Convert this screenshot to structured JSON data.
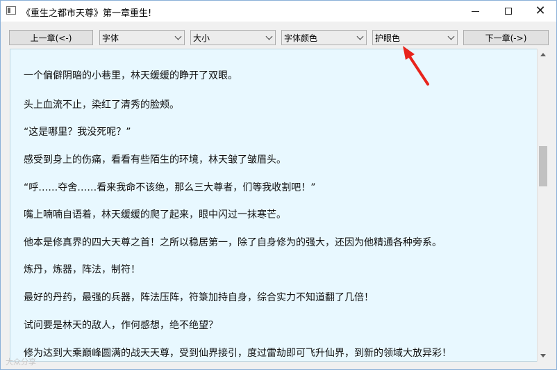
{
  "window": {
    "title": "《重生之都市天尊》第一章重生!",
    "controls": {
      "minimize": "minimize",
      "maximize": "maximize",
      "close": "close"
    }
  },
  "toolbar": {
    "prev_label": "上一章(<-)",
    "font_label": "字体",
    "size_label": "大小",
    "color_label": "字体颜色",
    "eye_label": "护眼色",
    "next_label": "下一章(->)"
  },
  "content": {
    "paragraphs": [
      "一个偏僻阴暗的小巷里，林天缓缓的睁开了双眼。",
      "头上血流不止，染红了清秀的脸颊。",
      "“这是哪里？我没死呢？”",
      "感受到身上的伤痛，看看有些陌生的环境，林天皱了皱眉头。",
      "“呼……夺舍……看来我命不该绝，那么三大尊者，们等我收割吧！”",
      "嘴上喃喃自语着，林天缓缓的爬了起来，眼中闪过一抹寒芒。",
      "他本是修真界的四大天尊之首！之所以稳居第一，除了自身修为的强大，还因为他精通各种旁系。",
      "炼丹，炼器，阵法，制符！",
      "最好的丹药，最强的兵器，阵法压阵，符箓加持自身，综合实力不知道翻了几倍！",
      "试问要是林天的敌人，作何感想，绝不绝望？",
      "修为达到大乘巅峰圆满的战天天尊，受到仙界接引，度过雷劫即可飞升仙界，到新的领域大放异彩！"
    ]
  },
  "colors": {
    "reader_background": "#e8f8ff",
    "annotation_arrow": "#e8241c"
  },
  "watermark": "大众分享"
}
